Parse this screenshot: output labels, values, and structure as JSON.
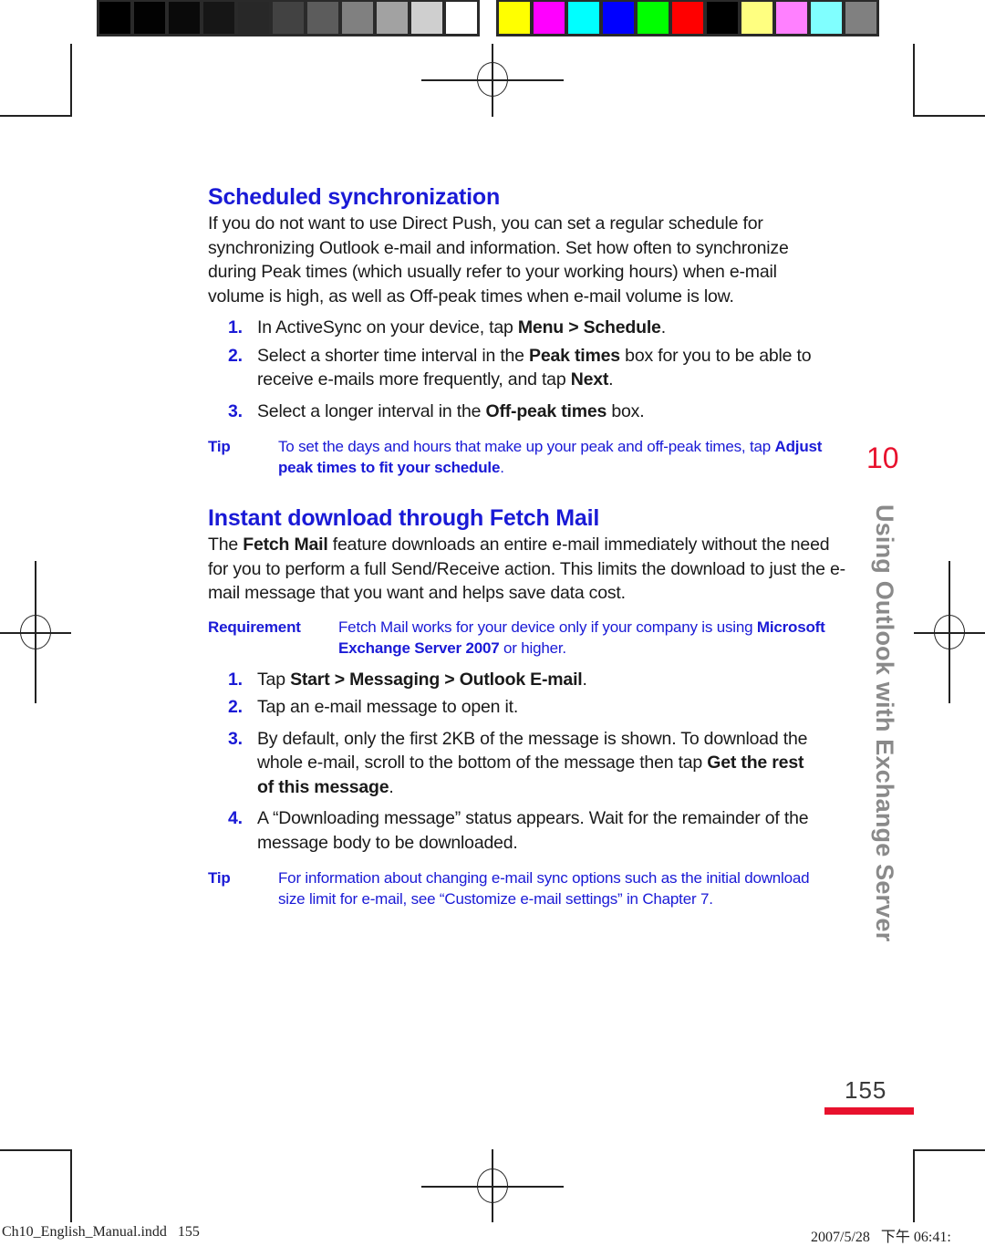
{
  "color_bars": {
    "grayscale": [
      "#000000",
      "#020202",
      "#0a0a0a",
      "#161616",
      "#282828",
      "#424242",
      "#5c5c5c",
      "#808080",
      "#a2a2a2",
      "#cfcfcf",
      "#ffffff"
    ],
    "process": [
      "#ffff00",
      "#ff00ff",
      "#00ffff",
      "#0000ff",
      "#00ff00",
      "#ff0000",
      "#000000",
      "#ffff80",
      "#ff80ff",
      "#80ffff",
      "#808080"
    ]
  },
  "accent_colors": {
    "heading": "#1a1ad6",
    "chapter": "#e8112d",
    "side_title": "#8a8a8a"
  },
  "section1": {
    "heading": "Scheduled synchronization",
    "intro": "If you do not want to use Direct Push, you can set a regular schedule for synchronizing Outlook e-mail and information. Set how often to synchronize during Peak times (which usually refer to your working hours) when e-mail volume is high, as well as Off-peak times when e-mail volume is low.",
    "steps": [
      {
        "num": "1.",
        "pre": "In ActiveSync on your device, tap ",
        "bold": "Menu > Schedule",
        "post": "."
      },
      {
        "num": "2.",
        "pre": "Select a shorter time interval in the ",
        "bold": "Peak times",
        "mid": " box for you to be able to receive e-mails more frequently, and tap ",
        "bold2": "Next",
        "post": "."
      },
      {
        "num": "3.",
        "pre": "Select a longer interval in the ",
        "bold": "Off-peak times",
        "post": " box."
      }
    ],
    "tip": {
      "label": "Tip",
      "text": "To set the days and hours that make up your peak and off-peak times, tap ",
      "bold": "Adjust peak times to fit your schedule",
      "post": "."
    }
  },
  "section2": {
    "heading": "Instant download through Fetch Mail",
    "intro_pre": "The ",
    "intro_bold": "Fetch Mail",
    "intro_post": " feature downloads an entire e-mail immediately without the need for you to perform a full Send/Receive action. This limits the download to just the e-mail message that you want and helps save data cost.",
    "requirement": {
      "label": "Requirement",
      "text": "Fetch Mail works for your device only if your company is using ",
      "bold": "Microsoft Exchange Server 2007",
      "post": " or higher."
    },
    "steps": [
      {
        "num": "1.",
        "pre": "Tap ",
        "bold": "Start > Messaging > Outlook E-mail",
        "post": "."
      },
      {
        "num": "2.",
        "pre": "Tap an e-mail message to open it."
      },
      {
        "num": "3.",
        "pre": "By default, only the first 2KB of the message is shown. To download the whole e-mail, scroll to the bottom of the message then tap ",
        "bold": "Get the rest of this message",
        "post": "."
      },
      {
        "num": "4.",
        "pre": "A “Downloading message” status appears. Wait for the remainder of the message body to be downloaded."
      }
    ],
    "tip": {
      "label": "Tip",
      "text": "For information about changing e-mail sync options such as the initial download size limit for e-mail, see “Customize e-mail settings” in Chapter 7."
    }
  },
  "side_tab": {
    "chapter_number": "10",
    "chapter_title": "Using Outlook with Exchange Server"
  },
  "page_number": "155",
  "slug": {
    "file": "Ch10_English_Manual.indd   155",
    "date": "2007/5/28   下午 06:41:"
  }
}
